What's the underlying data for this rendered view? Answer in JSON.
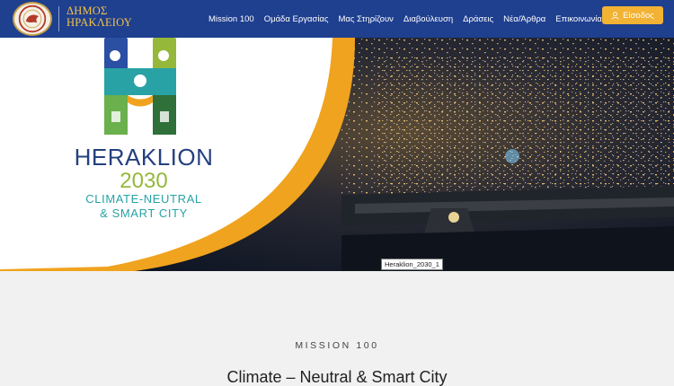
{
  "header": {
    "logo_text_line1": "ΔΗΜΟΣ",
    "logo_text_line2": "ΗΡΑΚΛΕΙΟΥ",
    "nav": [
      {
        "label": "Mission 100"
      },
      {
        "label": "Ομάδα Εργασίας"
      },
      {
        "label": "Μας Στηρίζουν"
      },
      {
        "label": "Διαβούλευση"
      },
      {
        "label": "Δράσεις"
      },
      {
        "label": "Νέα/Άρθρα"
      },
      {
        "label": "Επικοινωνία"
      }
    ],
    "login_label": "Είσοδος"
  },
  "hero": {
    "brand_line1": "HERAKLION",
    "brand_line2": "2030",
    "brand_line3": "CLIMATE-NEUTRAL",
    "brand_line4": "& SMART CITY",
    "image_caption": "Heraklion_2030_1"
  },
  "content": {
    "section_label": "MISSION 100",
    "section_title": "Climate – Neutral & Smart City"
  },
  "colors": {
    "header_bg": "#1f3f8f",
    "logo_gold": "#f2c34a",
    "login_bg": "#f2b233",
    "hero_orange": "#f0a31e",
    "brand_blue": "#25407f",
    "brand_green": "#95b83a",
    "brand_teal": "#28a2a5"
  }
}
